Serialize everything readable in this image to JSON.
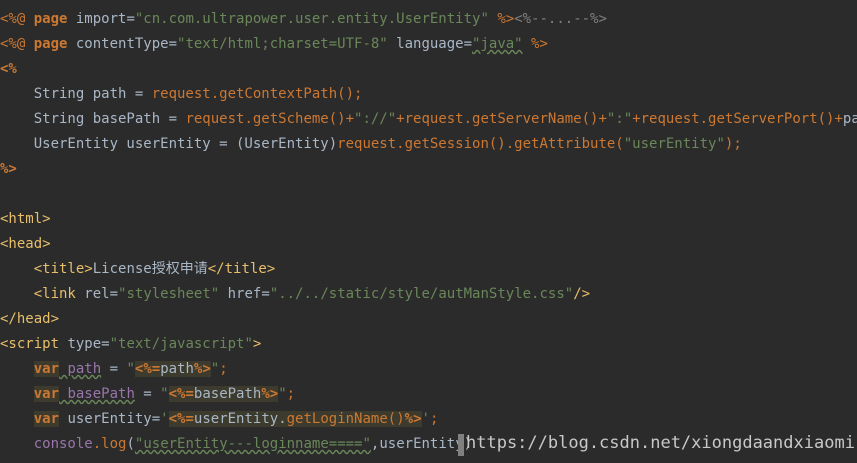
{
  "lines": {
    "l1": {
      "open": "<%@ ",
      "kw": "page",
      "attr": " import=",
      "val": "\"cn.com.ultrapower.user.entity.UserEntity\"",
      "close": " %>",
      "fold": "<%--...--%>"
    },
    "l2": {
      "open": "<%@ ",
      "kw": "page",
      "attr1": " contentType=",
      "val1": "\"text/html;charset=UTF-8\"",
      "attr2": " language=",
      "val2": "\"java\"",
      "close": " %>"
    },
    "l3": {
      "text": "<%"
    },
    "l4": {
      "type": "    String path = ",
      "call": "request.getContextPath();"
    },
    "l5": {
      "type": "    String basePath = ",
      "c1": "request.getScheme()+",
      "s1": "\"://\"",
      "c2": "+request.getServerName()+",
      "s2": "\":\"",
      "c3": "+request.getServerPort()+",
      "end": "path;"
    },
    "l6": {
      "type": "    UserEntity userEntity = (UserEntity)",
      "call": "request.getSession().getAttribute(",
      "s": "\"userEntity\"",
      "end": ");"
    },
    "l7": {
      "text": "%>"
    },
    "l9": {
      "text": "<html>"
    },
    "l10": {
      "text": "<head>"
    },
    "l11": {
      "indent": "    ",
      "open": "<title>",
      "content": "License授权申请",
      "close": "</title>"
    },
    "l12": {
      "indent": "    ",
      "open": "<link",
      "attr1": " rel=",
      "val1": "\"stylesheet\"",
      "attr2": " href=",
      "val2": "\"../../static/style/autManStyle.css\"",
      "close": "/>"
    },
    "l13": {
      "text": "</head>"
    },
    "l14": {
      "open": "<script",
      "attr": " type=",
      "val": "\"text/javascript\"",
      "close": ">"
    },
    "l15": {
      "indent": "    ",
      "kw": "var",
      "name": " path",
      "eq": " = ",
      "q1": "\"",
      "d1": "<%=",
      "expr": "path",
      "d2": "%>",
      "q2": "\"",
      "end": ";"
    },
    "l16": {
      "indent": "    ",
      "kw": "var",
      "name": " basePath",
      "eq": " = ",
      "q1": "\"",
      "d1": "<%=",
      "expr": "basePath",
      "d2": "%>",
      "q2": "\"",
      "end": ";"
    },
    "l17": {
      "indent": "    ",
      "kw": "var",
      "name": " userEntity=",
      "q1": "'",
      "d1": "<%=",
      "expr": "userEntity.",
      "call": "getLoginName()",
      "d2": "%>",
      "q2": "'",
      "end": ";"
    },
    "l18": {
      "indent": "    ",
      "obj": "console",
      "dot": ".",
      "fn": "log",
      "open": "(",
      "s": "\"userEntity---loginname====\"",
      "rest": ",userEntity)"
    }
  },
  "watermark": "https://blog.csdn.net/xiongdaandxiaomi"
}
